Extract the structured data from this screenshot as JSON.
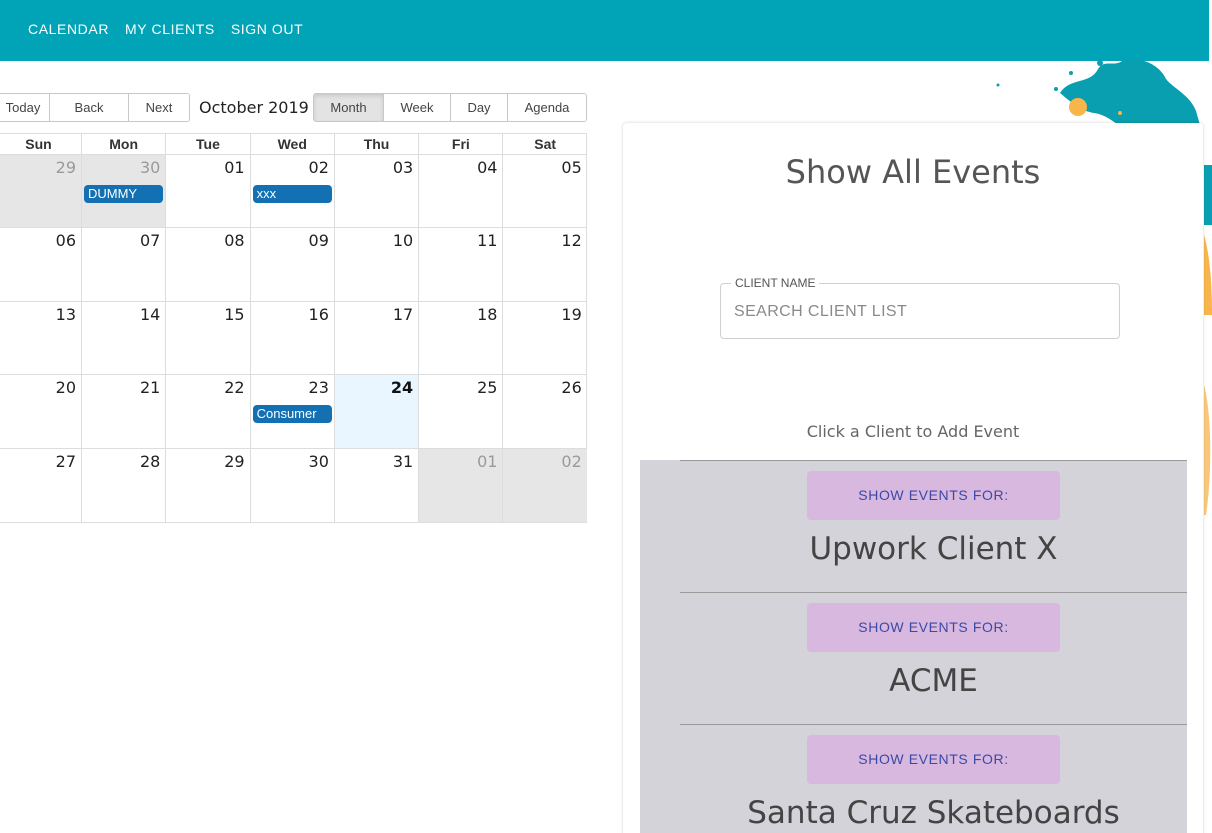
{
  "nav": {
    "items": [
      "CALENDAR",
      "MY CLIENTS",
      "SIGN OUT"
    ]
  },
  "toolbar": {
    "today": "Today",
    "back": "Back",
    "next": "Next",
    "label": "October 2019",
    "views": [
      "Month",
      "Week",
      "Day",
      "Agenda"
    ],
    "active_view": "Month"
  },
  "calendar": {
    "weekdays": [
      "Sun",
      "Mon",
      "Tue",
      "Wed",
      "Thu",
      "Fri",
      "Sat"
    ],
    "weeks": [
      [
        "29",
        "30",
        "01",
        "02",
        "03",
        "04",
        "05"
      ],
      [
        "06",
        "07",
        "08",
        "09",
        "10",
        "11",
        "12"
      ],
      [
        "13",
        "14",
        "15",
        "16",
        "17",
        "18",
        "19"
      ],
      [
        "20",
        "21",
        "22",
        "23",
        "24",
        "25",
        "26"
      ],
      [
        "27",
        "28",
        "29",
        "30",
        "31",
        "01",
        "02"
      ]
    ],
    "events": {
      "mon_30": "DUMMY",
      "wed_02": "xxx",
      "wed_23": "Consumer"
    }
  },
  "panel": {
    "title": "Show All Events",
    "search": {
      "legend": "CLIENT NAME",
      "placeholder": "SEARCH CLIENT LIST"
    },
    "hint": "Click a Client to Add Event",
    "show_label": "SHOW EVENTS FOR:",
    "clients": [
      "Upwork Client X",
      "ACME",
      "Santa Cruz Skateboards"
    ]
  },
  "colors": {
    "topbar": "#00a4b6",
    "event": "#1370b3",
    "show_button": "#d8b8de",
    "client_list_bg": "#d3d3d9"
  }
}
